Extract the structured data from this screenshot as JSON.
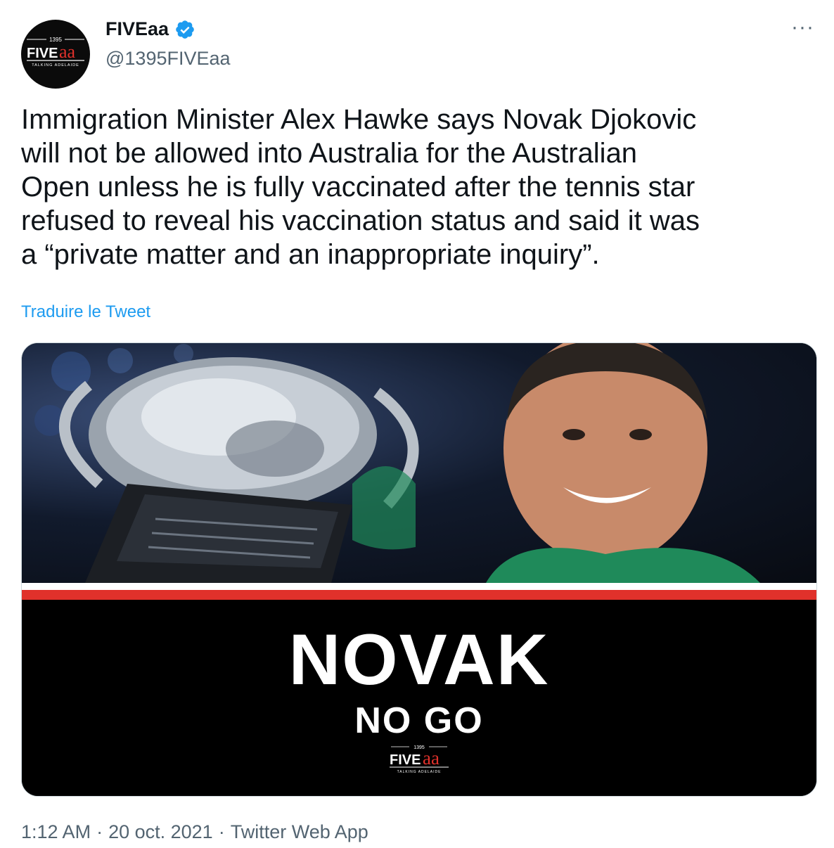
{
  "author": {
    "display_name": "FIVEaa",
    "handle": "@1395FIVEaa",
    "verified": true,
    "avatar_logo": {
      "top_text": "1395",
      "word_a": "FIVE",
      "word_b": "aa",
      "tagline": "TALKING ADELAIDE"
    }
  },
  "more_menu": "···",
  "tweet": {
    "text": "Immigration Minister Alex Hawke says Novak Djokovic\nwill not be allowed into Australia for the Australian\nOpen unless he is fully vaccinated after the tennis star\nrefused to reveal his vaccination status and said it was\na “private matter and an inappropriate inquiry”.",
    "translate_label": "Traduire le Tweet"
  },
  "media": {
    "headline": "NOVAK",
    "subhead": "NO GO",
    "logo": {
      "top_text": "1395",
      "word_a": "FIVE",
      "word_b": "aa",
      "tagline": "TALKING ADELAIDE"
    }
  },
  "footer": {
    "time": "1:12 AM",
    "sep1": "·",
    "date": "20 oct. 2021",
    "sep2": "·",
    "source": "Twitter Web App"
  },
  "colors": {
    "link": "#1d9bf0",
    "verified": "#1d9bf0",
    "secondary_text": "#536471",
    "banner_red": "#e0312b",
    "logo_red": "#e0312b"
  },
  "icons": {
    "verified": "verified-badge-icon",
    "more": "more-dots-icon"
  }
}
